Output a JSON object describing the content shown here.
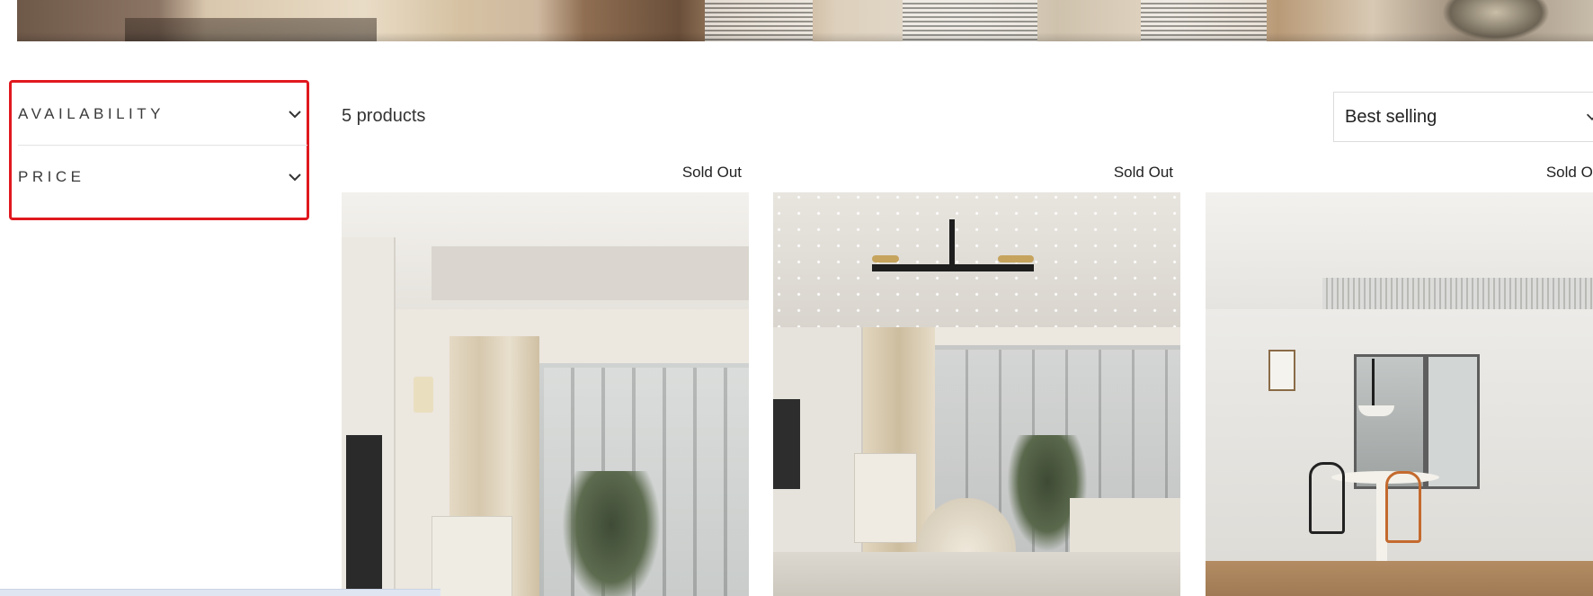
{
  "colors": {
    "highlight_border": "#e0191f",
    "text": "#222222",
    "divider": "#e3e3e3"
  },
  "filters": {
    "items": [
      {
        "label": "AVAILABILITY",
        "icon": "chevron-down-icon"
      },
      {
        "label": "PRICE",
        "icon": "chevron-down-icon"
      }
    ]
  },
  "toolbar": {
    "product_count": "5 products",
    "sort_selected": "Best selling"
  },
  "products": [
    {
      "badge": "Sold Out",
      "image": "living-room-with-curtains-photo"
    },
    {
      "badge": "Sold Out",
      "image": "living-room-with-chandelier-photo"
    },
    {
      "badge": "Sold Out",
      "image": "dining-room-with-pendant-lamp-photo"
    }
  ]
}
